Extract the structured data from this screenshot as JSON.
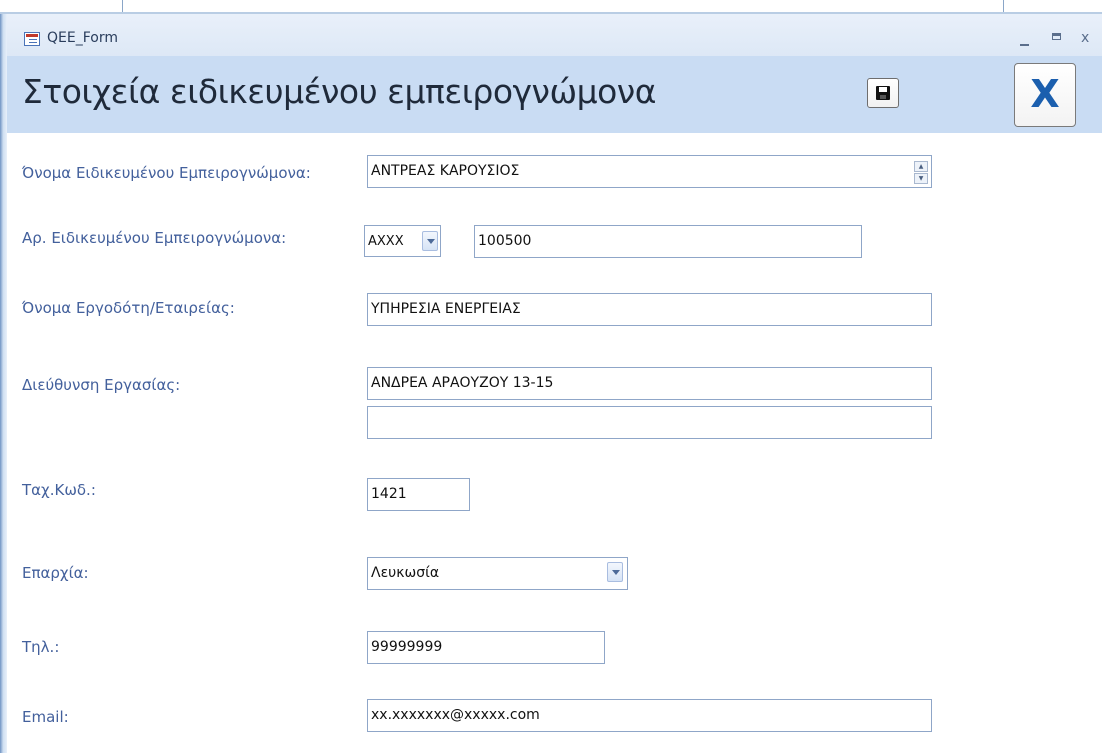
{
  "window": {
    "title": "QEE_Form"
  },
  "header": {
    "title": "Στοιχεία ειδικευμένου εμπειρογνώμονα",
    "close_label": "X"
  },
  "fields": {
    "expert_name": {
      "label": "Όνομα Ειδικευμένου Εμπειρογνώμονα:",
      "value": "ΑΝΤΡΕΑΣ ΚΑΡΟΥΣΙΟΣ"
    },
    "expert_number": {
      "label": "Αρ.  Ειδικευμένου Εμπειρογνώμονα:",
      "prefix_value": "AXXX",
      "value": "100500"
    },
    "employer_name": {
      "label": "Όνομα Εργοδότη/Εταιρείας:",
      "value": "ΥΠΗΡΕΣΙΑ ΕΝΕΡΓΕΙΑΣ"
    },
    "work_address": {
      "label": "Διεύθυνση Εργασίας:",
      "line1": "ΑΝΔΡΕΑ ΑΡΑΟΥΖΟΥ 13-15",
      "line2": ""
    },
    "postal_code": {
      "label": "Ταχ.Κωδ.:",
      "value": "1421"
    },
    "district": {
      "label": "Επαρχία:",
      "value": "Λευκωσία"
    },
    "phone": {
      "label": "Τηλ.:",
      "value": "99999999"
    },
    "email": {
      "label": "Email:",
      "value": "xx.xxxxxxx@xxxxx.com"
    }
  },
  "colors": {
    "header_background": "#c9dcf3",
    "label_text": "#43609c",
    "close_glyph": "#1b5fae"
  }
}
